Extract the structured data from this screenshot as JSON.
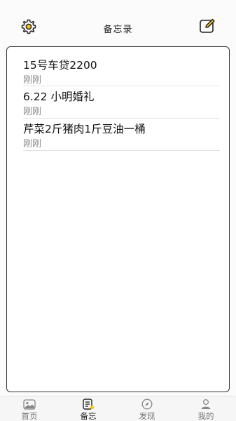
{
  "header": {
    "title": "备忘录",
    "settings_icon": "gear-icon",
    "compose_icon": "edit-note-icon",
    "accent": "#f5c518"
  },
  "notes": [
    {
      "title": "15号车贷2200",
      "time": "刚刚"
    },
    {
      "title": "6.22 小明婚礼",
      "time": "刚刚"
    },
    {
      "title": "芹菜2斤猪肉1斤豆油一桶",
      "time": "刚刚"
    }
  ],
  "tabbar": {
    "active": "memo",
    "tabs": [
      {
        "key": "home",
        "label": "首页",
        "icon": "image-icon"
      },
      {
        "key": "memo",
        "label": "备忘",
        "icon": "memo-icon"
      },
      {
        "key": "discover",
        "label": "发现",
        "icon": "compass-icon"
      },
      {
        "key": "mine",
        "label": "我的",
        "icon": "person-icon"
      }
    ]
  }
}
